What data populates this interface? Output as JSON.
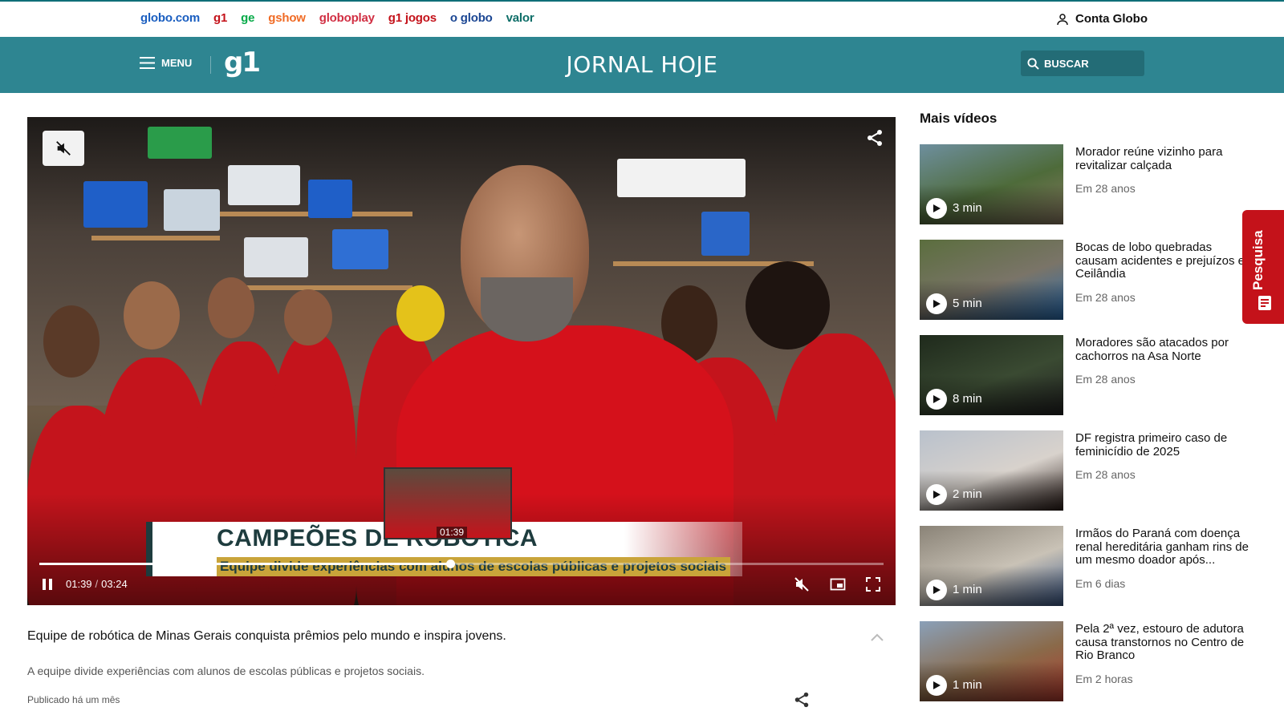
{
  "topbar": {
    "links": [
      {
        "label": "globo.com",
        "color": "#1a5ec0"
      },
      {
        "label": "g1",
        "color": "#c4121a"
      },
      {
        "label": "ge",
        "color": "#06aa48"
      },
      {
        "label": "gshow",
        "color": "#f06b25"
      },
      {
        "label": "globoplay",
        "color": "#d12f43"
      },
      {
        "label": "g1 jogos",
        "color": "#c4121a"
      },
      {
        "label": "o globo",
        "color": "#1b4693"
      },
      {
        "label": "valor",
        "color": "#0e6e68"
      }
    ],
    "account_label": "Conta Globo"
  },
  "header": {
    "menu_label": "MENU",
    "logo": "g1",
    "show_title": "JORNAL HOJE",
    "search_label": "BUSCAR",
    "bg_color": "#2e8591"
  },
  "player": {
    "lower_third_title": "CAMPEÕES DE ROBÓTICA",
    "lower_third_subtitle": "Equipe divide experiências com alunos de escolas públicas e projetos sociais",
    "preview_time": "01:39",
    "current_time": "01:39",
    "duration": "03:24",
    "progress_fraction": 0.487,
    "muted": true
  },
  "video": {
    "title": "Equipe de robótica de Minas Gerais conquista prêmios pelo mundo e inspira jovens.",
    "description": "A equipe divide experiências com alunos de escolas públicas e projetos sociais.",
    "published": "Publicado há um mês"
  },
  "sidebar": {
    "title": "Mais vídeos",
    "items": [
      {
        "title": "Morador reúne vizinho para revitalizar calçada",
        "time": "Em 28 anos",
        "duration": "3 min",
        "thumb_colors": [
          "#6e8f9e",
          "#4e6b3a",
          "#8a7a62"
        ]
      },
      {
        "title": "Bocas de lobo quebradas causam acidentes e prejuízos em Ceilândia",
        "time": "Em 28 anos",
        "duration": "5 min",
        "thumb_colors": [
          "#5b6e3e",
          "#7a7468",
          "#2a6db0"
        ]
      },
      {
        "title": "Moradores são atacados por cachorros na Asa Norte",
        "time": "Em 28 anos",
        "duration": "8 min",
        "thumb_colors": [
          "#1f2a1c",
          "#3a4a32",
          "#222"
        ]
      },
      {
        "title": "DF registra primeiro caso de feminicídio de 2025",
        "time": "Em 28 anos",
        "duration": "2 min",
        "thumb_colors": [
          "#b9c1cc",
          "#d8d2cc",
          "#2a1c18"
        ]
      },
      {
        "title": "Irmãos do Paraná com doença renal hereditária ganham rins de um mesmo doador após...",
        "time": "Em 6 dias",
        "duration": "1 min",
        "thumb_colors": [
          "#8a8377",
          "#c9c2b6",
          "#3d5a8a"
        ]
      },
      {
        "title": "Pela 2ª vez, estouro de adutora causa transtornos no Centro de Rio Branco",
        "time": "Em 2 horas",
        "duration": "1 min",
        "thumb_colors": [
          "#8aa0b8",
          "#8a6a4a",
          "#b03a2e"
        ]
      }
    ]
  },
  "pesquisa_label": "Pesquisa"
}
